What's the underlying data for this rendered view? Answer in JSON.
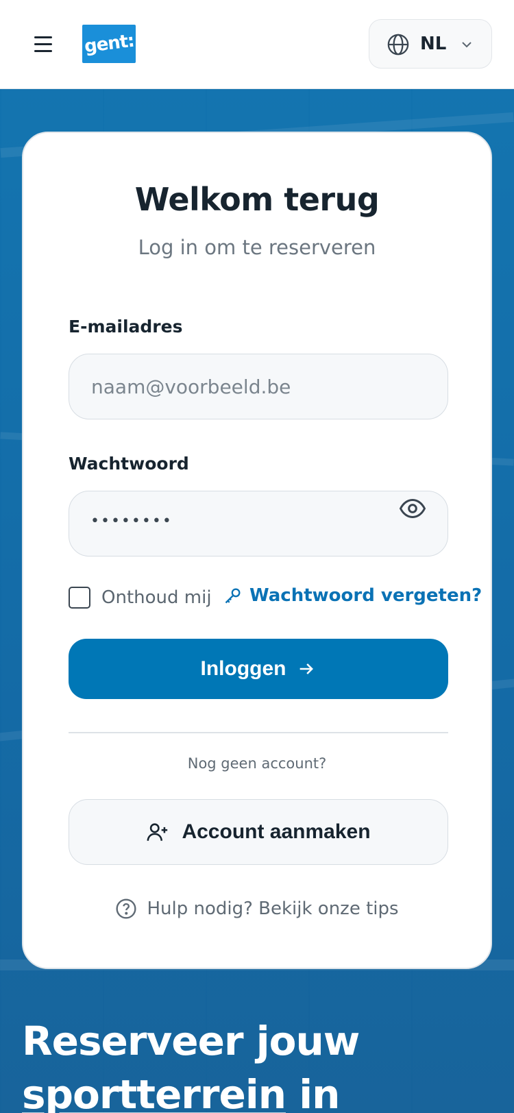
{
  "header": {
    "logo_text": "gent:",
    "language": {
      "label": "NL"
    },
    "menu_icon": "hamburger-menu-icon"
  },
  "login": {
    "title": "Welkom terug",
    "subtitle": "Log in om te reserveren",
    "email": {
      "label": "E-mailadres",
      "placeholder": "naam@voorbeeld.be",
      "value": ""
    },
    "password": {
      "label": "Wachtwoord",
      "value": "••••••••"
    },
    "remember_label": "Onthoud mij",
    "remember_checked": false,
    "forgot_label": "Wachtwoord vergeten?",
    "submit_label": "Inloggen",
    "no_account_text": "Nog geen account?",
    "create_account_label": "Account aanmaken",
    "help_label": "Hulp nodig? Bekijk onze tips"
  },
  "hero": {
    "heading_line1": "Reserveer jouw",
    "heading_word_underlined": "sportterrein",
    "heading_rest": " in"
  },
  "colors": {
    "primary": "#0077b6",
    "link": "#0a72b5",
    "logo_bg": "#1a8fd9",
    "text_dark": "#17242f"
  }
}
